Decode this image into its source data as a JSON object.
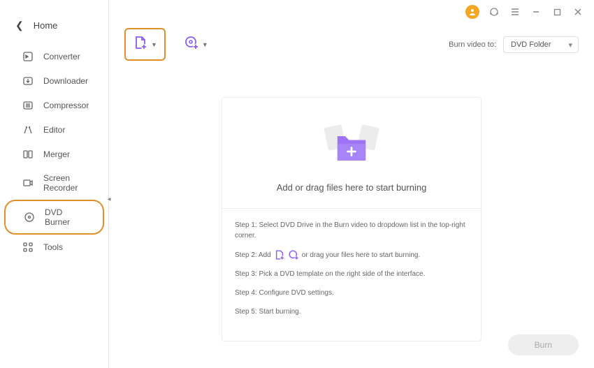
{
  "sidebar": {
    "home": "Home",
    "items": [
      {
        "label": "Converter"
      },
      {
        "label": "Downloader"
      },
      {
        "label": "Compressor"
      },
      {
        "label": "Editor"
      },
      {
        "label": "Merger"
      },
      {
        "label": "Screen Recorder"
      },
      {
        "label": "DVD Burner"
      },
      {
        "label": "Tools"
      }
    ]
  },
  "toolbar": {
    "burn_to_label": "Burn video to:",
    "burn_to_value": "DVD Folder"
  },
  "dropzone": {
    "text": "Add or drag files here to start burning"
  },
  "steps": {
    "s1": "Step 1: Select DVD Drive in the Burn video to dropdown list in the top-right corner.",
    "s2a": "Step 2: Add",
    "s2b": "or drag your files here to start burning.",
    "s3": "Step 3: Pick a DVD template on the right side of the interface.",
    "s4": "Step 4: Configure DVD settings.",
    "s5": "Step 5: Start burning."
  },
  "footer": {
    "burn": "Burn"
  }
}
